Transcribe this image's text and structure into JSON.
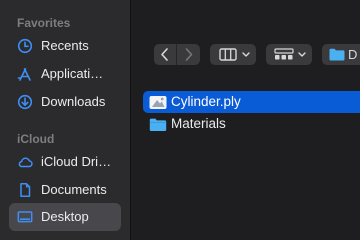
{
  "sidebar": {
    "favorites_label": "Favorites",
    "favorites": [
      {
        "label": "Recents",
        "icon": "clock-icon"
      },
      {
        "label": "Applicati…",
        "icon": "applications-icon"
      },
      {
        "label": "Downloads",
        "icon": "download-icon"
      }
    ],
    "icloud_label": "iCloud",
    "icloud": [
      {
        "label": "iCloud Dri…",
        "icon": "cloud-icon"
      },
      {
        "label": "Documents",
        "icon": "document-icon"
      },
      {
        "label": "Desktop",
        "icon": "desktop-icon",
        "selected": true
      }
    ]
  },
  "toolbar": {
    "back": "back-icon",
    "forward": "forward-icon",
    "view": "column-view-icon",
    "group": "group-icon",
    "path_label": "D"
  },
  "files": [
    {
      "name": "Cylinder.ply",
      "icon": "ply-file-icon",
      "selected": true
    },
    {
      "name": "Materials",
      "icon": "folder-icon",
      "selected": false
    }
  ],
  "colors": {
    "accent": "#0a5bd6",
    "icon_blue": "#3e8ff5",
    "folder": "#4ab0f2"
  }
}
